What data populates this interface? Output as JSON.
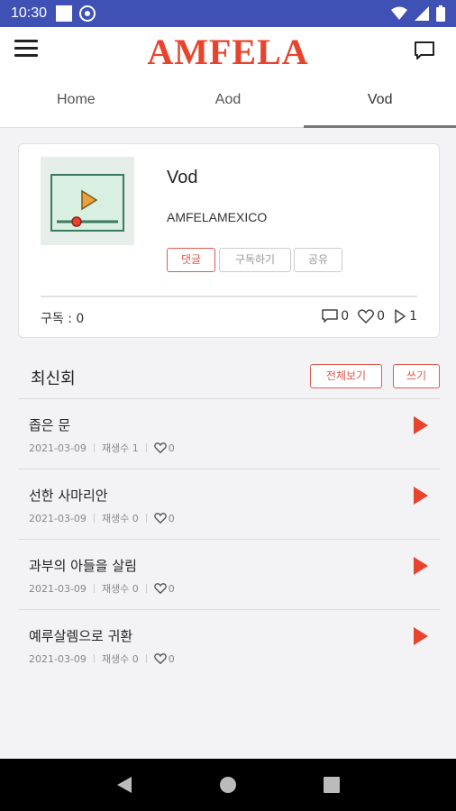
{
  "status_bar": {
    "time": "10:30"
  },
  "app": {
    "logo": "AMFELA"
  },
  "tabs": [
    {
      "label": "Home"
    },
    {
      "label": "Aod"
    },
    {
      "label": "Vod"
    }
  ],
  "card": {
    "title": "Vod",
    "owner": "AMFELAMEXICO",
    "chips": {
      "comment": "댓글",
      "subscribe": "구독하기",
      "share": "공유"
    },
    "subs": "구독 : 0",
    "stats": {
      "comments": "0",
      "likes": "0",
      "plays": "1"
    }
  },
  "latest": {
    "title": "최신회",
    "view_all": "전체보기",
    "write": "쓰기",
    "items": [
      {
        "title": "좁은 문",
        "date": "2021-03-09",
        "plays": "재생수 1",
        "likes": "0"
      },
      {
        "title": "선한 사마리안",
        "date": "2021-03-09",
        "plays": "재생수 0",
        "likes": "0"
      },
      {
        "title": "과부의 아들을 살림",
        "date": "2021-03-09",
        "plays": "재생수 0",
        "likes": "0"
      },
      {
        "title": "예루살렘으로 귀환",
        "date": "2021-03-09",
        "plays": "재생수 0",
        "likes": "0"
      }
    ]
  },
  "colors": {
    "status_bar": "#3f51b5",
    "accent": "#e8442d"
  }
}
